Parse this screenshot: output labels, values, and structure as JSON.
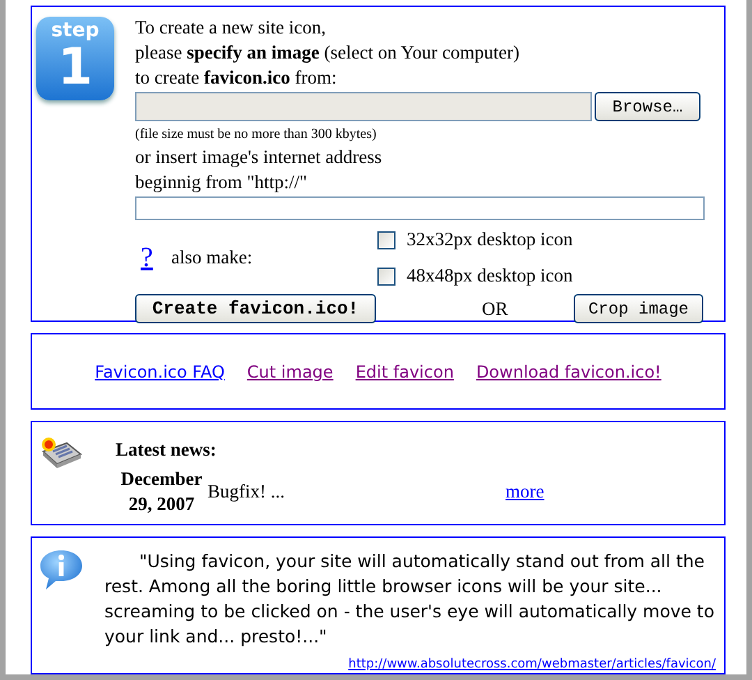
{
  "step_badge": {
    "label": "step",
    "number": "1"
  },
  "intro": [
    "To create a new site icon,",
    "please **specify an image** (select on Your computer)",
    "to create **favicon.ico** from:"
  ],
  "file_field": {
    "button": "Browse…"
  },
  "size_note": "(file size must be no more than 300 kbytes)",
  "url_intro": [
    "or insert image's internet address",
    "beginnig from \"http://\""
  ],
  "help_link": "?",
  "also_make": "also make:",
  "options": [
    {
      "label": "32x32px desktop icon",
      "checked": false
    },
    {
      "label": "48x48px desktop icon",
      "checked": false
    }
  ],
  "create_button": "Create favicon.ico!",
  "or_text": "OR",
  "crop_button": "Crop image",
  "links": [
    {
      "label": "Favicon.ico FAQ",
      "visited": false
    },
    {
      "label": "Cut image",
      "visited": true
    },
    {
      "label": "Edit favicon",
      "visited": true
    },
    {
      "label": "Download favicon.ico!",
      "visited": true
    }
  ],
  "news": {
    "heading": "Latest news:",
    "date": "December 29, 2007",
    "text": "Bugfix! ...",
    "more": "more"
  },
  "quote": {
    "text": "\"Using favicon, your site will automatically stand out from all the rest. Among all the boring little browser icons will be your site... screaming to be clicked on - the user's eye will automatically move to your link and... presto!...\"",
    "source": "http://www.absolutecross.com/webmaster/articles/favicon/"
  }
}
